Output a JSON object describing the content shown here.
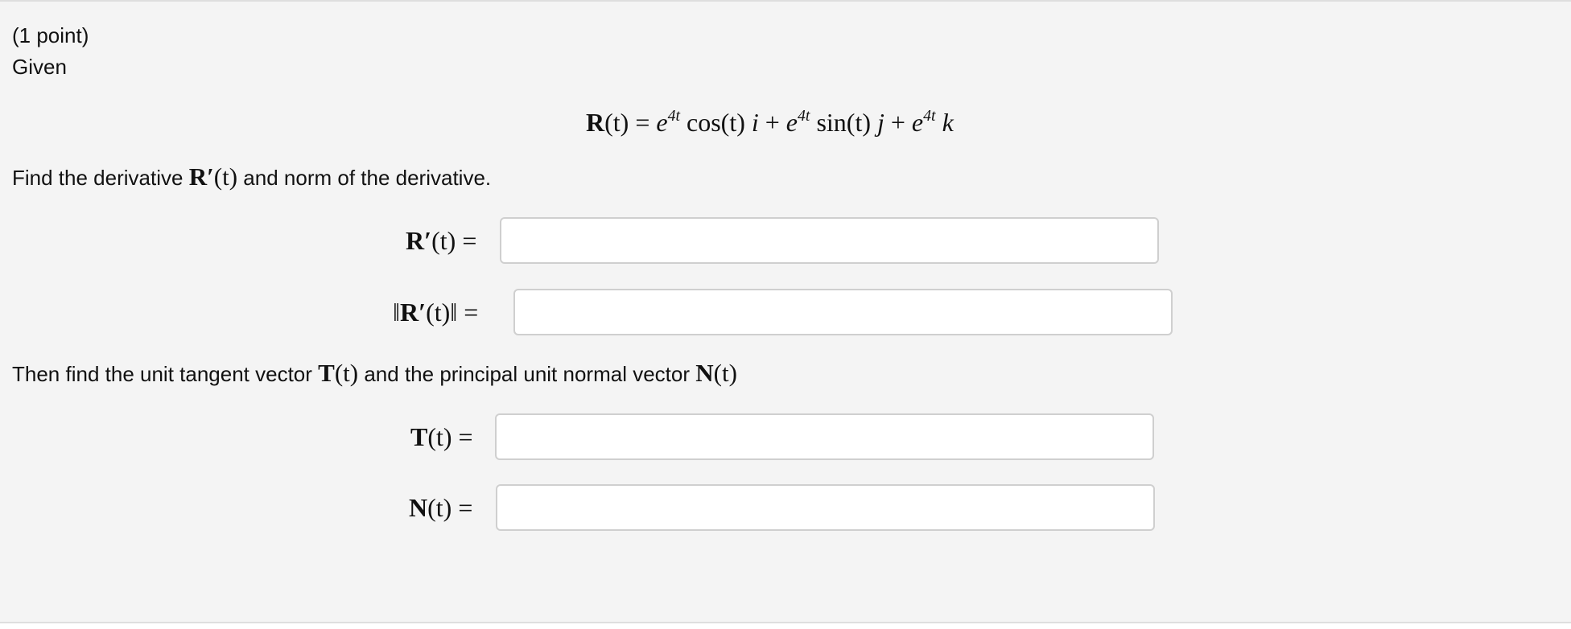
{
  "problem": {
    "points": "(1 point)",
    "given": "Given",
    "equation": {
      "lhs": "R",
      "lhs_arg": "(t)",
      "equals": "=",
      "term1_base": "e",
      "term1_exp": "4t",
      "term1_func": "cos(t)",
      "term1_unit": "i",
      "plus1": "+",
      "term2_base": "e",
      "term2_exp": "4t",
      "term2_func": "sin(t)",
      "term2_unit": "j",
      "plus2": "+",
      "term3_base": "e",
      "term3_exp": "4t",
      "term3_unit": "k"
    },
    "instruction1": {
      "before": "Find the derivative",
      "math": "R′",
      "math_arg": "(t)",
      "after": "and norm of the derivative."
    },
    "instruction2": {
      "before": "Then find the unit tangent vector",
      "math1": "T",
      "math1_arg": "(t)",
      "middle": "and the principal unit normal vector",
      "math2": "N",
      "math2_arg": "(t)"
    },
    "fields": [
      {
        "label_bold": "R′",
        "label_arg": "(t)",
        "label_eq": "=",
        "value": "",
        "prefix": "",
        "suffix": ""
      },
      {
        "label_bold": "R′",
        "label_arg": "(t)",
        "label_eq": "=",
        "value": "",
        "prefix": "‖",
        "suffix": "‖"
      },
      {
        "label_bold": "T",
        "label_arg": "(t)",
        "label_eq": "=",
        "value": "",
        "prefix": "",
        "suffix": ""
      },
      {
        "label_bold": "N",
        "label_arg": "(t)",
        "label_eq": "=",
        "value": "",
        "prefix": "",
        "suffix": ""
      }
    ]
  }
}
